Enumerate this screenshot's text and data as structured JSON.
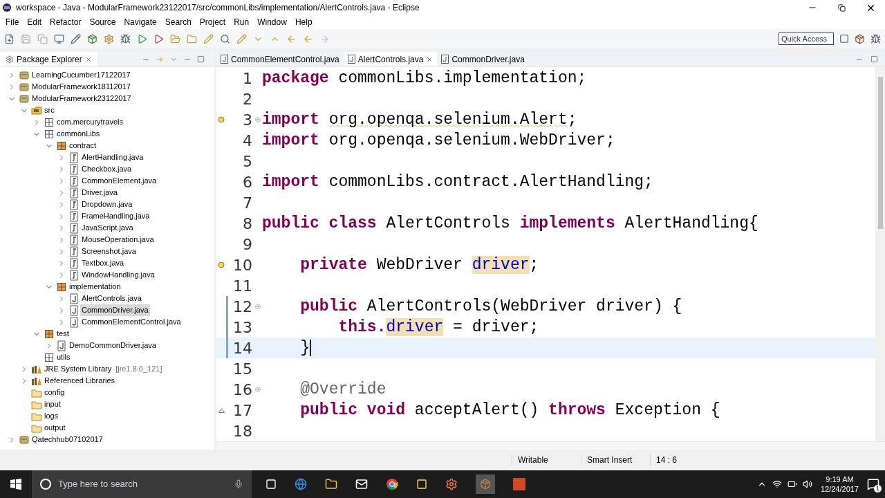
{
  "window": {
    "title": "workspace - Java - ModularFramework23122017/src/commonLibs/implementation/AlertControls.java - Eclipse"
  },
  "menu": [
    "File",
    "Edit",
    "Refactor",
    "Source",
    "Navigate",
    "Search",
    "Project",
    "Run",
    "Window",
    "Help"
  ],
  "quick_access": {
    "placeholder": "Quick Access"
  },
  "package_explorer": {
    "title": "Package Explorer",
    "tree": [
      {
        "label": "LearningCucumber17122017",
        "kind": "project",
        "expanded": false,
        "selected": false
      },
      {
        "label": "ModularFramework18112017",
        "kind": "project",
        "expanded": false,
        "selected": false
      },
      {
        "label": "ModularFramework23122017",
        "kind": "project",
        "expanded": true,
        "selected": false,
        "children": [
          {
            "label": "src",
            "kind": "src",
            "expanded": true,
            "selected": false,
            "children": [
              {
                "label": "com.mercurytravels",
                "kind": "package",
                "expanded": false,
                "selected": false
              },
              {
                "label": "commonLibs",
                "kind": "package",
                "expanded": true,
                "selected": false,
                "children": [
                  {
                    "label": "contract",
                    "kind": "package-brown",
                    "expanded": true,
                    "selected": false,
                    "children": [
                      {
                        "label": "AlertHandling.java",
                        "kind": "interface",
                        "expanded": false,
                        "selected": false
                      },
                      {
                        "label": "Checkbox.java",
                        "kind": "interface",
                        "expanded": false,
                        "selected": false
                      },
                      {
                        "label": "CommonElement.java",
                        "kind": "interface",
                        "expanded": false,
                        "selected": false
                      },
                      {
                        "label": "Driver.java",
                        "kind": "interface",
                        "expanded": false,
                        "selected": false
                      },
                      {
                        "label": "Dropdown.java",
                        "kind": "interface",
                        "expanded": false,
                        "selected": false
                      },
                      {
                        "label": "FrameHandling.java",
                        "kind": "interface",
                        "expanded": false,
                        "selected": false
                      },
                      {
                        "label": "JavaScript.java",
                        "kind": "interface",
                        "expanded": false,
                        "selected": false
                      },
                      {
                        "label": "MouseOperation.java",
                        "kind": "interface",
                        "expanded": false,
                        "selected": false
                      },
                      {
                        "label": "Screenshot.java",
                        "kind": "interface",
                        "expanded": false,
                        "selected": false
                      },
                      {
                        "label": "Textbox.java",
                        "kind": "interface",
                        "expanded": false,
                        "selected": false
                      },
                      {
                        "label": "WindowHandling.java",
                        "kind": "interface",
                        "expanded": false,
                        "selected": false
                      }
                    ]
                  },
                  {
                    "label": "implementation",
                    "kind": "package-brown",
                    "expanded": true,
                    "selected": false,
                    "children": [
                      {
                        "label": "AlertControls.java",
                        "kind": "class",
                        "expanded": false,
                        "selected": false
                      },
                      {
                        "label": "CommonDriver.java",
                        "kind": "class",
                        "expanded": false,
                        "selected": true
                      },
                      {
                        "label": "CommonElementControl.java",
                        "kind": "class",
                        "expanded": false,
                        "selected": false
                      }
                    ]
                  }
                ]
              },
              {
                "label": "test",
                "kind": "package-brown",
                "expanded": true,
                "selected": false,
                "children": [
                  {
                    "label": "DemoCommonDriver.java",
                    "kind": "class",
                    "expanded": false,
                    "selected": false
                  }
                ]
              },
              {
                "label": "utils",
                "kind": "package",
                "selected": false
              }
            ]
          },
          {
            "label": "JRE System Library",
            "note": "[jre1.8.0_121]",
            "kind": "library",
            "expanded": false,
            "selected": false
          },
          {
            "label": "Referenced Libraries",
            "kind": "library",
            "expanded": false,
            "selected": false
          },
          {
            "label": "config",
            "kind": "folder",
            "selected": false
          },
          {
            "label": "input",
            "kind": "folder",
            "selected": false
          },
          {
            "label": "logs",
            "kind": "folder",
            "selected": false
          },
          {
            "label": "output",
            "kind": "folder",
            "selected": false
          }
        ]
      },
      {
        "label": "Qatechhub07102017",
        "kind": "project",
        "expanded": false,
        "selected": false
      }
    ]
  },
  "editor": {
    "tabs": [
      {
        "label": "CommonElementControl.java",
        "selected": false
      },
      {
        "label": "AlertControls.java",
        "selected": true
      },
      {
        "label": "CommonDriver.java",
        "selected": false
      }
    ],
    "lines": [
      {
        "number": "1",
        "current": false,
        "changed": false,
        "tokens": [
          {
            "text": "package",
            "kind": "keyword"
          },
          {
            "text": " commonLibs.implementation;",
            "kind": "plain"
          }
        ]
      },
      {
        "number": "2",
        "current": false,
        "changed": false
      },
      {
        "number": "3",
        "current": false,
        "changed": false,
        "kind": "warning",
        "fold": true,
        "tokens": [
          {
            "text": "import",
            "kind": "keyword"
          },
          {
            "text": " org.openqa.selenium.Alert",
            "kind": "warning"
          },
          {
            "text": ";",
            "kind": "plain"
          }
        ]
      },
      {
        "number": "4",
        "current": false,
        "changed": false,
        "tokens": [
          {
            "text": "import",
            "kind": "keyword"
          },
          {
            "text": " org.openqa.selenium.WebDriver;",
            "kind": "plain"
          }
        ]
      },
      {
        "number": "5",
        "current": false,
        "changed": false
      },
      {
        "number": "6",
        "current": false,
        "changed": false,
        "tokens": [
          {
            "text": "import",
            "kind": "keyword"
          },
          {
            "text": " commonLibs.contract.AlertHandling;",
            "kind": "plain"
          }
        ]
      },
      {
        "number": "7",
        "current": false,
        "changed": false
      },
      {
        "number": "8",
        "current": false,
        "changed": false,
        "tokens": [
          {
            "text": "public class",
            "kind": "keyword"
          },
          {
            "text": " AlertControls ",
            "kind": "plain"
          },
          {
            "text": "implements",
            "kind": "keyword"
          },
          {
            "text": " AlertHandling{",
            "kind": "plain"
          }
        ]
      },
      {
        "number": "9",
        "current": false,
        "changed": false
      },
      {
        "number": "10",
        "current": false,
        "changed": false,
        "kind": "warning",
        "tokens": [
          {
            "text": "    private",
            "kind": "keyword"
          },
          {
            "text": " WebDriver ",
            "kind": "plain"
          },
          {
            "text": "driver",
            "kind": "field-highlight"
          },
          {
            "text": ";",
            "kind": "plain"
          }
        ]
      },
      {
        "number": "11",
        "current": false,
        "changed": false
      },
      {
        "number": "12",
        "current": false,
        "changed": true,
        "fold": true,
        "tokens": [
          {
            "text": "    public",
            "kind": "keyword"
          },
          {
            "text": " AlertControls(WebDriver driver) {",
            "kind": "plain"
          }
        ]
      },
      {
        "number": "13",
        "current": false,
        "changed": true,
        "tokens": [
          {
            "text": "        this.",
            "kind": "keyword"
          },
          {
            "text": "driver",
            "kind": "field-highlight"
          },
          {
            "text": " = driver;",
            "kind": "plain"
          }
        ]
      },
      {
        "number": "14",
        "current": true,
        "changed": true,
        "tokens": [
          {
            "text": "    }",
            "kind": "plain"
          }
        ]
      },
      {
        "number": "15",
        "current": false,
        "changed": false
      },
      {
        "number": "16",
        "current": false,
        "changed": false,
        "fold": true,
        "tokens": [
          {
            "text": "    @Override",
            "kind": "annotation"
          }
        ]
      },
      {
        "number": "17",
        "current": false,
        "changed": false,
        "kind": "override",
        "tokens": [
          {
            "text": "    public void",
            "kind": "keyword"
          },
          {
            "text": " acceptAlert() ",
            "kind": "plain"
          },
          {
            "text": "throws",
            "kind": "keyword"
          },
          {
            "text": " Exception {",
            "kind": "plain"
          }
        ]
      },
      {
        "number": "18",
        "current": false,
        "changed": false
      }
    ]
  },
  "status_bar": [
    "Writable",
    "Smart Insert",
    "14 : 6"
  ],
  "taskbar": {
    "search": {
      "placeholder": "Type here to search"
    },
    "time": "9:19 AM",
    "date": "12/24/2017",
    "notifications": "1"
  }
}
